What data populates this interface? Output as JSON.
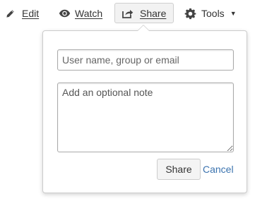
{
  "toolbar": {
    "edit_label": "Edit",
    "watch_label": "Watch",
    "share_label": "Share",
    "tools_label": "Tools",
    "tools_caret": "▼"
  },
  "share_dialog": {
    "recipients_placeholder": "User name, group or email",
    "recipients_value": "",
    "note_placeholder": "Add an optional note",
    "note_value": "",
    "share_button_label": "Share",
    "cancel_label": "Cancel"
  },
  "colors": {
    "link": "#3b73af",
    "text": "#333333",
    "border": "#cccccc"
  },
  "icons": {
    "edit": "pencil-icon",
    "watch": "eye-icon",
    "share": "share-icon",
    "tools": "gear-icon"
  }
}
